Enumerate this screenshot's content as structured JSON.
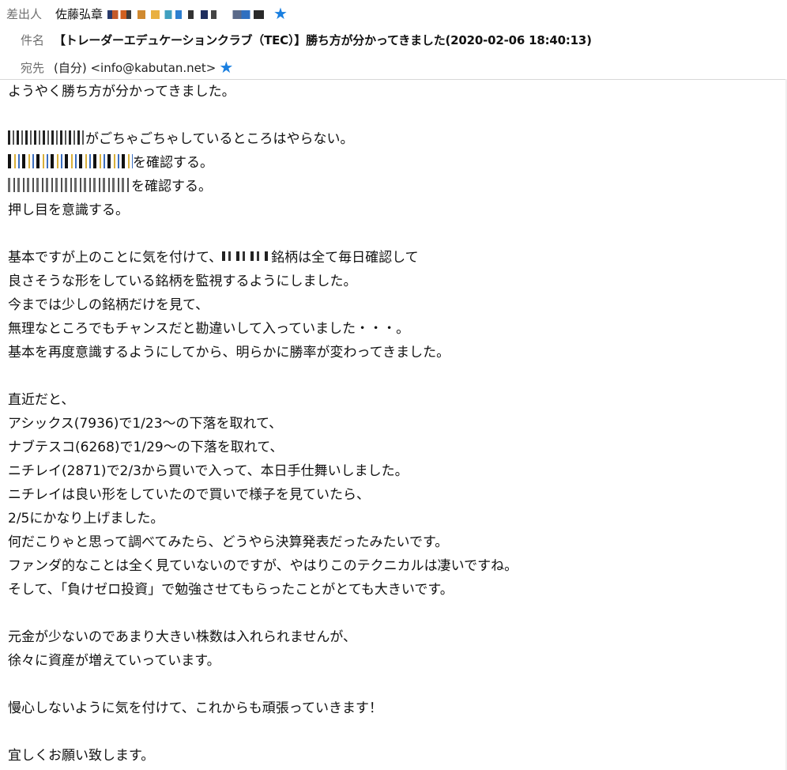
{
  "header": {
    "from_label": "差出人",
    "from_name": "佐藤弘章",
    "subject_label": "件名",
    "subject": "【トレーダーエデュケーションクラブ（TEC）】勝ち方が分かってきました(2020-02-06 18:40:13)",
    "to_label": "宛先",
    "to_value": "(自分) <info@kabutan.net>",
    "icons": {
      "star": "star-icon"
    },
    "accent_color": "#1a7fe0"
  },
  "body": {
    "lines": [
      "ようやく勝ち方が分かってきました。",
      "",
      "がごちゃごちゃしているところはやらない。",
      "を確認する。",
      "を確認する。",
      "押し目を意識する。",
      "",
      "基本ですが上のことに気を付けて、",
      "銘柄は全て毎日確認して",
      "良さそうな形をしている銘柄を監視するようにしました。",
      "今までは少しの銘柄だけを見て、",
      "無理なところでもチャンスだと勘違いして入っていました・・・。",
      "基本を再度意識するようにしてから、明らかに勝率が変わってきました。",
      "",
      "直近だと、",
      "アシックス(7936)で1/23～の下落を取れて、",
      "ナブテスコ(6268)で1/29～の下落を取れて、",
      "ニチレイ(2871)で2/3から買いで入って、本日手仕舞いしました。",
      "ニチレイは良い形をしていたので買いで様子を見ていたら、",
      "2/5にかなり上げました。",
      "何だこりゃと思って調べてみたら、どうやら決算発表だったみたいです。",
      "ファンダ的なことは全く見ていないのですが、やはりこのテクニカルは凄いですね。",
      "そして、「負けゼロ投資」で勉強させてもらったことがとても大きいです。",
      "",
      "元金が少ないのであまり大きい株数は入れられませんが、",
      "徐々に資産が増えていっています。",
      "",
      "慢心しないように気を付けて、これからも頑張っていきます！",
      "",
      "宜しくお願い致します。"
    ]
  }
}
